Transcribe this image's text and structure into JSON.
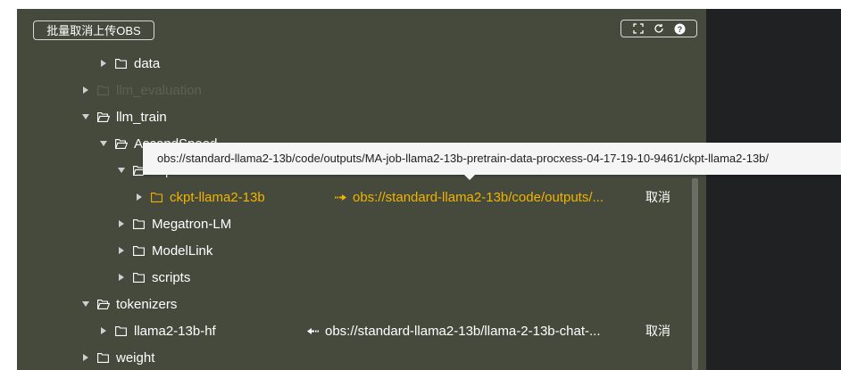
{
  "toolbar": {
    "batch_cancel_label": "批量取消上传OBS",
    "icons": [
      "fullscreen-icon",
      "refresh-icon",
      "help-icon"
    ]
  },
  "tree": [
    {
      "label": "data",
      "state": "collapsed"
    },
    {
      "label": "llm_evaluation",
      "state": "collapsed",
      "dimmed": true
    },
    {
      "label": "llm_train",
      "state": "expanded"
    },
    {
      "label": "AscendSpeed",
      "state": "expanded"
    },
    {
      "label": "ckpt",
      "state": "expanded"
    },
    {
      "label": "ckpt-llama2-13b",
      "state": "collapsed",
      "highlighted": true,
      "sync_path": "obs://standard-llama2-13b/code/outputs/...",
      "sync_direction": "upload",
      "cancel_label": "取消"
    },
    {
      "label": "Megatron-LM",
      "state": "collapsed"
    },
    {
      "label": "ModelLink",
      "state": "collapsed"
    },
    {
      "label": "scripts",
      "state": "collapsed"
    },
    {
      "label": "tokenizers",
      "state": "expanded"
    },
    {
      "label": "llama2-13b-hf",
      "state": "collapsed",
      "sync_path": "obs://standard-llama2-13b/llama-2-13b-chat-...",
      "sync_direction": "download",
      "cancel_label": "取消"
    },
    {
      "label": "weight",
      "state": "collapsed"
    }
  ],
  "tooltip": {
    "text": "obs://standard-llama2-13b/code/outputs/MA-job-llama2-13b-pretrain-data-procxess-04-17-19-10-9461/ckpt-llama2-13b/"
  },
  "colors": {
    "panel_bg": "#464a3d",
    "highlight": "#f0b400",
    "dim_text": "#5d6151",
    "right_bg": "#1f2123"
  }
}
